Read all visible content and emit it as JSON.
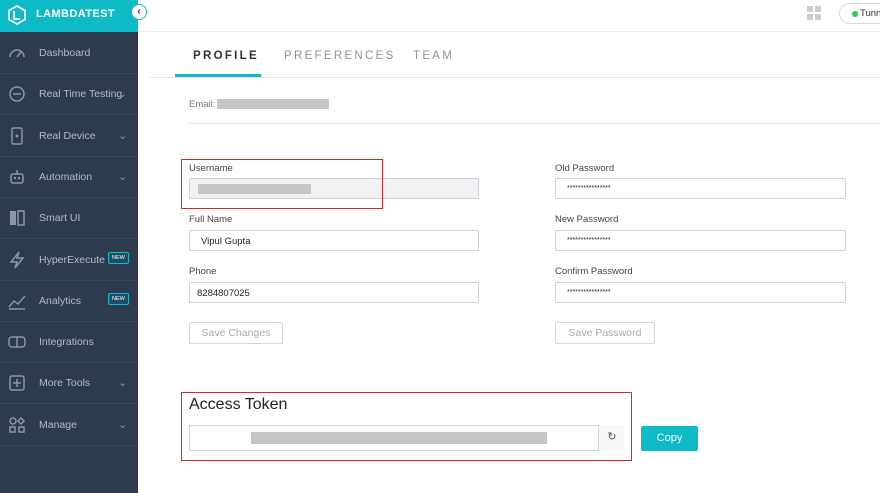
{
  "brand": {
    "name": "LAMBDATEST",
    "collapse_glyph": "‹"
  },
  "colors": {
    "accent": "#0ebac5",
    "sidebar_bg": "#2e3b4e",
    "highlight_box": "#e0242a",
    "online_dot": "#2ecc40"
  },
  "sidebar": {
    "items": [
      {
        "label": "Dashboard",
        "icon": "dashboard-gauge-icon",
        "chevron": false
      },
      {
        "label": "Real Time Testing",
        "icon": "real-time-clock-icon",
        "chevron": true
      },
      {
        "label": "Real Device",
        "icon": "mobile-device-icon",
        "chevron": true
      },
      {
        "label": "Automation",
        "icon": "robot-icon",
        "chevron": true
      },
      {
        "label": "Smart UI",
        "icon": "smart-ui-icon",
        "chevron": false
      },
      {
        "label": "HyperExecute",
        "icon": "lightning-icon",
        "chevron": false,
        "badge": "NEW"
      },
      {
        "label": "Analytics",
        "icon": "analytics-chart-icon",
        "chevron": false,
        "badge": "NEW"
      },
      {
        "label": "Integrations",
        "icon": "integrations-icon",
        "chevron": false
      },
      {
        "label": "More Tools",
        "icon": "plus-square-icon",
        "chevron": true
      },
      {
        "label": "Manage",
        "icon": "manage-grid-icon",
        "chevron": true
      }
    ],
    "chevron_glyph": "⌄"
  },
  "topbar": {
    "tunnel_label": "Tunn",
    "grid_icon": "app-grid-icon"
  },
  "tabs": [
    {
      "label": "PROFILE",
      "active": true
    },
    {
      "label": "PREFERENCES",
      "active": false
    },
    {
      "label": "TEAM",
      "active": false
    }
  ],
  "profile": {
    "email_label": "Email:",
    "username_label": "Username",
    "fullname_label": "Full Name",
    "fullname_value": "Vipul Gupta",
    "phone_label": "Phone",
    "phone_value": "8284807025",
    "save_changes": "Save Changes"
  },
  "password": {
    "old_label": "Old Password",
    "old_value": "****************",
    "new_label": "New Password",
    "new_value": "****************",
    "confirm_label": "Confirm Password",
    "confirm_value": "****************",
    "save_password": "Save Password"
  },
  "token": {
    "title": "Access Token",
    "refresh_glyph": "↻",
    "copy_label": "Copy"
  }
}
